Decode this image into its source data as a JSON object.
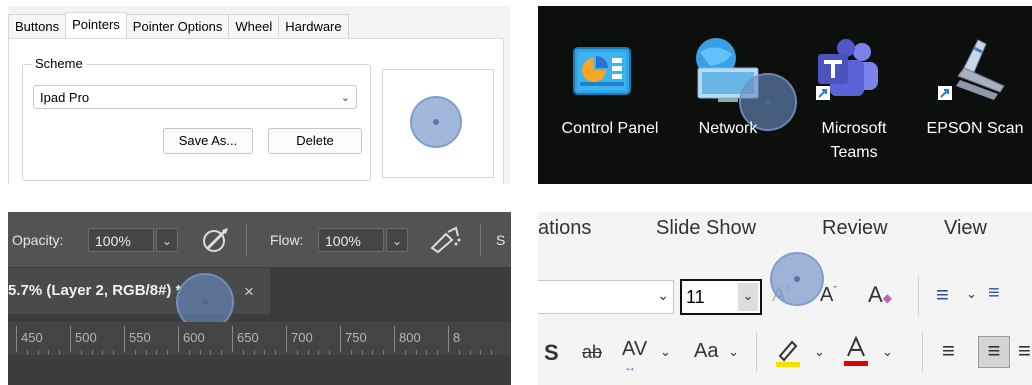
{
  "mouse_props": {
    "tabs": [
      "Buttons",
      "Pointers",
      "Pointer Options",
      "Wheel",
      "Hardware"
    ],
    "active_tab": "Pointers",
    "scheme_label": "Scheme",
    "scheme_value": "Ipad Pro",
    "save_as_label": "Save As...",
    "delete_label": "Delete"
  },
  "desktop": {
    "icons": [
      "Control Panel",
      "Network",
      "Microsoft",
      "Teams",
      "EPSON Scan"
    ]
  },
  "photoshop": {
    "opacity_label": "Opacity:",
    "opacity_value": "100%",
    "flow_label": "Flow:",
    "flow_value": "100%",
    "toolbar_trailing": "S",
    "doc_tab_label": "5.7% (Layer 2, RGB/8#) *",
    "close_glyph": "×",
    "ruler_ticks": [
      "450",
      "500",
      "550",
      "600",
      "650",
      "700",
      "750",
      "800",
      "8"
    ]
  },
  "powerpoint": {
    "menu": [
      "ations",
      "Slide Show",
      "Review",
      "View"
    ],
    "font_size": "11",
    "colors": {
      "highlight": "#f6e000",
      "font_color": "#e00000"
    }
  }
}
